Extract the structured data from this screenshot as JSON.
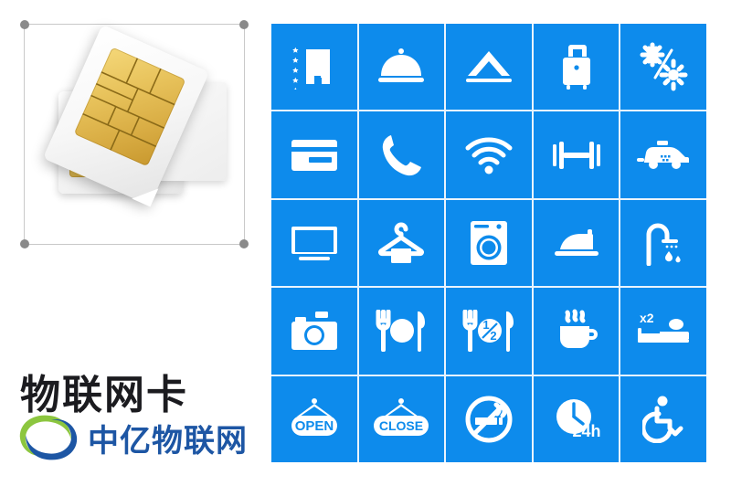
{
  "page": {
    "background_color": "#ffffff",
    "accent_color": "#0d8bec"
  },
  "left_panel": {
    "selection_frame": {
      "name": "image-selection-frame",
      "handle_color": "#8a8a8a",
      "border_color": "#c9c9c9"
    },
    "image": {
      "alt": "sim-card-photo",
      "description": "Two white SIM cards with gold contact chips"
    },
    "title": "物联网卡",
    "title_color": "#1b1b1f",
    "logo": {
      "text": "中亿物联网",
      "text_color": "#1d56a4",
      "mark_green": "#8cc63f",
      "mark_blue": "#1d56a4"
    }
  },
  "icon_grid": {
    "columns": 5,
    "rows": 5,
    "tile_color": "#0d8bec",
    "icon_color": "#ffffff",
    "gap_color": "#e9f4fd",
    "tiles": [
      {
        "name": "hotel-stars-icon",
        "label": "Star Hotel"
      },
      {
        "name": "room-service-bell-icon",
        "label": "Room Service"
      },
      {
        "name": "tent-camping-icon",
        "label": "Camping"
      },
      {
        "name": "luggage-icon",
        "label": "Luggage Storage"
      },
      {
        "name": "air-conditioning-icon",
        "label": "Air Conditioning"
      },
      {
        "name": "credit-card-icon",
        "label": "Card Payment"
      },
      {
        "name": "telephone-icon",
        "label": "Telephone"
      },
      {
        "name": "wifi-icon",
        "label": "Wi-Fi"
      },
      {
        "name": "dumbbell-gym-icon",
        "label": "Fitness"
      },
      {
        "name": "taxi-icon",
        "label": "Taxi"
      },
      {
        "name": "television-icon",
        "label": "Television"
      },
      {
        "name": "clothes-hanger-icon",
        "label": "Laundry"
      },
      {
        "name": "washing-machine-icon",
        "label": "Washing Machine"
      },
      {
        "name": "iron-icon",
        "label": "Ironing"
      },
      {
        "name": "shower-icon",
        "label": "Shower"
      },
      {
        "name": "camera-icon",
        "label": "Photography"
      },
      {
        "name": "restaurant-icon",
        "label": "Full Board"
      },
      {
        "name": "half-board-icon",
        "label": "Half Board"
      },
      {
        "name": "coffee-cup-icon",
        "label": "Coffee"
      },
      {
        "name": "double-bed-icon",
        "label": "Double Room"
      },
      {
        "name": "open-sign-icon",
        "label": "OPEN"
      },
      {
        "name": "close-sign-icon",
        "label": "CLOSE"
      },
      {
        "name": "no-smoking-icon",
        "label": "No Smoking"
      },
      {
        "name": "clock-24h-icon",
        "label": "24 Hours"
      },
      {
        "name": "wheelchair-access-icon",
        "label": "Accessible"
      }
    ],
    "tile_text": {
      "open": "OPEN",
      "close": "CLOSE",
      "half": "1/2",
      "bed_count": "x2",
      "hours": "24h"
    }
  }
}
